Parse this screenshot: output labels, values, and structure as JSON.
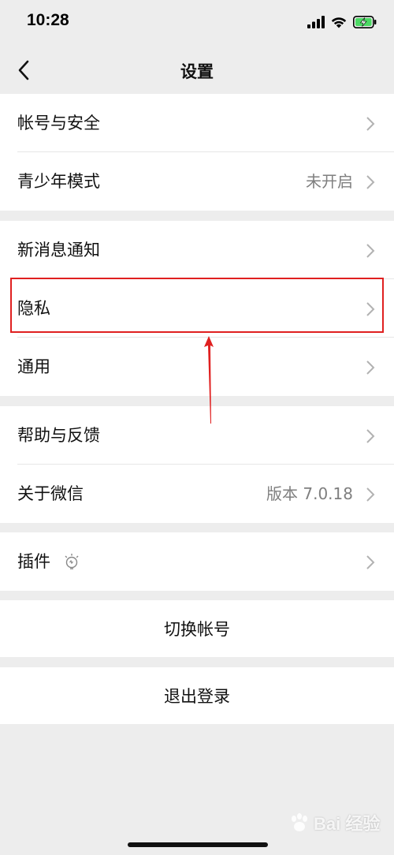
{
  "status_bar": {
    "time": "10:28"
  },
  "nav": {
    "title": "设置"
  },
  "groups": [
    {
      "items": [
        {
          "label": "帐号与安全",
          "value": ""
        },
        {
          "label": "青少年模式",
          "value": "未开启"
        }
      ]
    },
    {
      "items": [
        {
          "label": "新消息通知",
          "value": ""
        },
        {
          "label": "隐私",
          "value": ""
        },
        {
          "label": "通用",
          "value": ""
        }
      ]
    },
    {
      "items": [
        {
          "label": "帮助与反馈",
          "value": ""
        },
        {
          "label": "关于微信",
          "value": "版本 7.0.18"
        }
      ]
    },
    {
      "items": [
        {
          "label": "插件",
          "value": ""
        }
      ]
    }
  ],
  "actions": {
    "switch_account": "切换帐号",
    "logout": "退出登录"
  },
  "annotation": {
    "highlight_color": "#e02020"
  },
  "watermark": {
    "text": "Bai 经验"
  },
  "colors": {
    "background": "#ededed",
    "row": "#ffffff",
    "secondary_text": "#7f7f7f",
    "battery": "#4cd964"
  }
}
